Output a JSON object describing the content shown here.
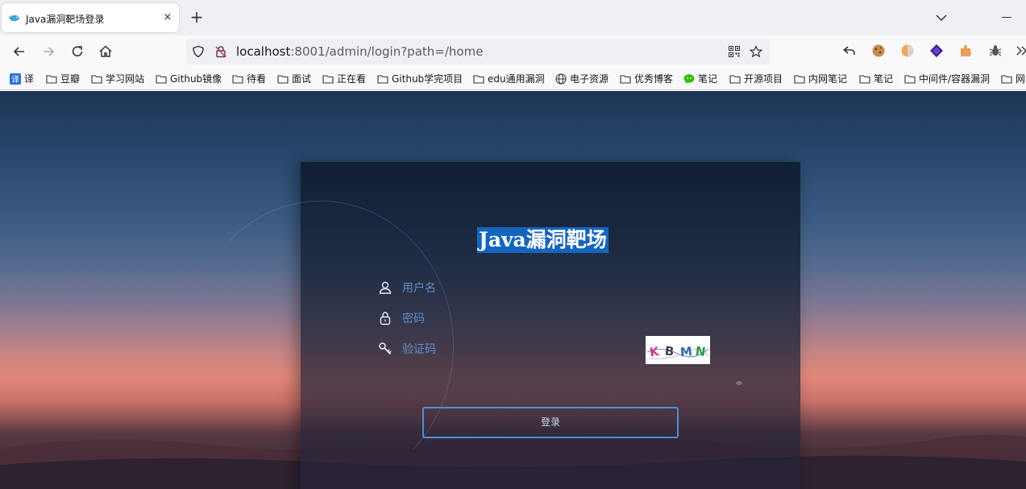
{
  "tab": {
    "title": "Java漏洞靶场登录",
    "close": "×"
  },
  "newtab": "+",
  "address": {
    "host": "localhost",
    "rest": ":8001/admin/login?path=/home"
  },
  "bookmarks": [
    {
      "label": "译",
      "icon": "translate-icon"
    },
    {
      "label": "豆瓣",
      "icon": "folder-icon"
    },
    {
      "label": "学习网站",
      "icon": "folder-icon"
    },
    {
      "label": "Github镜像",
      "icon": "folder-icon"
    },
    {
      "label": "待看",
      "icon": "folder-icon"
    },
    {
      "label": "面试",
      "icon": "folder-icon"
    },
    {
      "label": "正在看",
      "icon": "folder-icon"
    },
    {
      "label": "Github学完项目",
      "icon": "folder-icon"
    },
    {
      "label": "edu通用漏洞",
      "icon": "folder-icon"
    },
    {
      "label": "电子资源",
      "icon": "globe-icon"
    },
    {
      "label": "优秀博客",
      "icon": "folder-icon"
    },
    {
      "label": "笔记",
      "icon": "wechat-icon"
    },
    {
      "label": "开源项目",
      "icon": "folder-icon"
    },
    {
      "label": "内网笔记",
      "icon": "folder-icon"
    },
    {
      "label": "笔记",
      "icon": "folder-icon"
    },
    {
      "label": "中间件/容器漏洞",
      "icon": "folder-icon"
    },
    {
      "label": "网",
      "icon": "folder-icon"
    }
  ],
  "login": {
    "title": "Java漏洞靶场",
    "username_placeholder": "用户名",
    "password_placeholder": "密码",
    "captcha_placeholder": "验证码",
    "captcha_text": "KBMN",
    "submit": "登录"
  },
  "colors": {
    "accent": "#4a90d9",
    "title_bg": "#1565c0",
    "placeholder": "#5a8fc8"
  }
}
